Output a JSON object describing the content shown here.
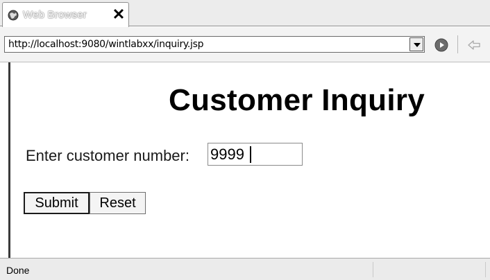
{
  "tab": {
    "label": "Web Browser",
    "icon": "globe-icon",
    "close_glyph": "✕"
  },
  "toolbar": {
    "url": "http://localhost:9080/wintlabxx/inquiry.jsp",
    "go_icon": "go-icon",
    "back_icon": "back-arrow-icon"
  },
  "page": {
    "title": "Customer Inquiry",
    "field_label": "Enter customer number:",
    "field_value": "9999",
    "submit_label": "Submit",
    "reset_label": "Reset"
  },
  "status": {
    "text": "Done"
  }
}
